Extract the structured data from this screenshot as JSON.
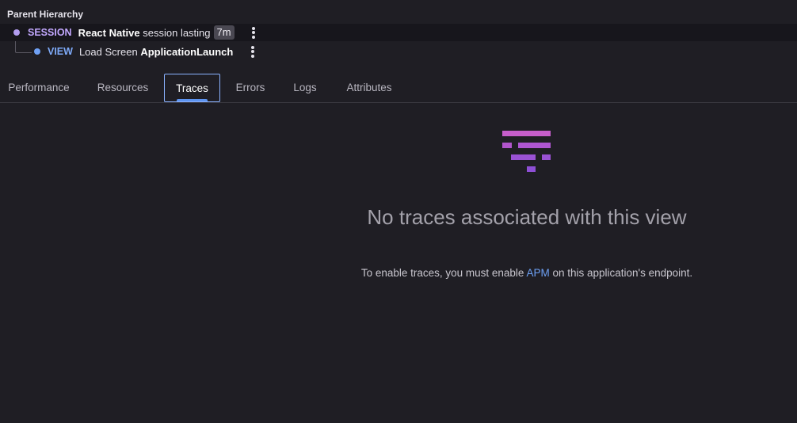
{
  "hierarchy": {
    "title": "Parent Hierarchy",
    "session": {
      "type": "SESSION",
      "name": "React Native",
      "text": "session lasting",
      "duration": "7m",
      "color": "#c3a8ff"
    },
    "view": {
      "type": "VIEW",
      "prefix": "Load Screen",
      "name": "ApplicationLaunch",
      "color": "#7eaaf8"
    }
  },
  "tabs": [
    {
      "label": "Performance"
    },
    {
      "label": "Resources"
    },
    {
      "label": "Traces",
      "active": true
    },
    {
      "label": "Errors"
    },
    {
      "label": "Logs"
    },
    {
      "label": "Attributes"
    }
  ],
  "empty_state": {
    "icon": "traces-filter-icon",
    "title": "No traces associated with this view",
    "desc_before": "To enable traces, you must enable",
    "link_text": "APM",
    "desc_after": "on this application's endpoint.",
    "link_color": "#6ea1f5",
    "icon_colors": [
      "#c65ecb",
      "#a853d0",
      "#8e4fd6"
    ]
  }
}
